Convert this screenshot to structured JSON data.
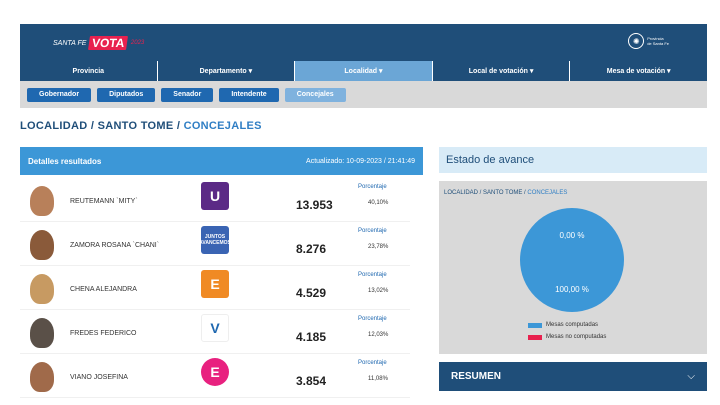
{
  "header": {
    "logo_prefix": "SANTA FE",
    "logo_main": "VOTA",
    "logo_year": "2023",
    "gov_line1": "Provincia",
    "gov_line2": "de Santa Fe"
  },
  "nav": [
    {
      "label": "Provincia"
    },
    {
      "label": "Departamento ▾"
    },
    {
      "label": "Localidad ▾"
    },
    {
      "label": "Local de votación ▾"
    },
    {
      "label": "Mesa de votación ▾"
    }
  ],
  "subnav": [
    {
      "label": "Gobernador"
    },
    {
      "label": "Diputados"
    },
    {
      "label": "Senador"
    },
    {
      "label": "Intendente"
    },
    {
      "label": "Concejales"
    }
  ],
  "breadcrumb": {
    "a": "LOCALIDAD",
    "sep1": " / ",
    "b": "SANTO TOME",
    "sep2": " / ",
    "c": "CONCEJALES"
  },
  "results": {
    "title": "Detalles resultados",
    "updated": "Actualizado: 10-09-2023 / 21:41:49",
    "pct_label": "Porcentaje",
    "rows": [
      {
        "name": "REUTEMANN `MITY`",
        "party_mark": "U",
        "votes": "13.953",
        "pct": "40,10%",
        "party_color": "#5b2a86",
        "avatar_color": "#b8805a"
      },
      {
        "name": "ZAMORA ROSANA `CHANI`",
        "party_mark": "JUNTOS AVANCEMOS",
        "votes": "8.276",
        "pct": "23,78%",
        "party_color": "#3a64b3",
        "avatar_color": "#8a5a3a"
      },
      {
        "name": "CHENA ALEJANDRA",
        "party_mark": "E",
        "votes": "4.529",
        "pct": "13,02%",
        "party_color": "#f08a24",
        "avatar_color": "#c79a62"
      },
      {
        "name": "FREDES FEDERICO",
        "party_mark": "V",
        "votes": "4.185",
        "pct": "12,03%",
        "party_color": "#ffffff",
        "avatar_color": "#5a5048"
      },
      {
        "name": "VIANO JOSEFINA",
        "party_mark": "E",
        "votes": "3.854",
        "pct": "11,08%",
        "party_color": "#e8217f",
        "avatar_color": "#a06a4a"
      }
    ]
  },
  "progress": {
    "title": "Estado de avance",
    "crumb_a": "LOCALIDAD",
    "crumb_b": "SANTO TOME",
    "crumb_c": "CONCEJALES",
    "not_computed_pct": "0,00 %",
    "computed_pct": "100,00 %",
    "computed_fraction": 1.0,
    "legend_computed": "Mesas computadas",
    "legend_not_computed": "Mesas no computadas",
    "color_computed": "#3c97d7",
    "color_not_computed": "#e8214f"
  },
  "resumen": {
    "label": "RESUMEN",
    "icon": "chevron-down-icon"
  }
}
